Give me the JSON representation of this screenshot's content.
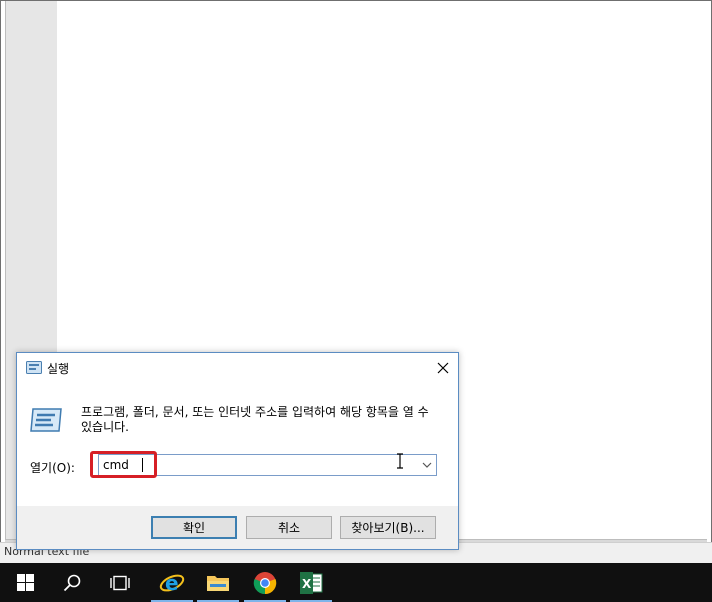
{
  "editor": {
    "status_text": "Normal text file"
  },
  "run_dialog": {
    "title": "실행",
    "description": "프로그램, 폴더, 문서, 또는 인터넷 주소를 입력하여 해당 항목을 열 수\n있습니다.",
    "open_label": "열기(O):",
    "command_value": "cmd",
    "buttons": {
      "ok": "확인",
      "cancel": "취소",
      "browse": "찾아보기(B)..."
    },
    "highlight_color": "#d61f26"
  },
  "taskbar": {
    "items": [
      {
        "name": "start",
        "icon": "windows-logo-icon"
      },
      {
        "name": "search",
        "icon": "search-icon"
      },
      {
        "name": "task-view",
        "icon": "task-view-icon"
      },
      {
        "name": "internet-explorer",
        "icon": "internet-explorer-icon",
        "active": true
      },
      {
        "name": "file-explorer",
        "icon": "folder-icon",
        "active": true
      },
      {
        "name": "chrome",
        "icon": "chrome-icon",
        "active": true
      },
      {
        "name": "excel",
        "icon": "excel-icon",
        "active": true
      }
    ]
  }
}
